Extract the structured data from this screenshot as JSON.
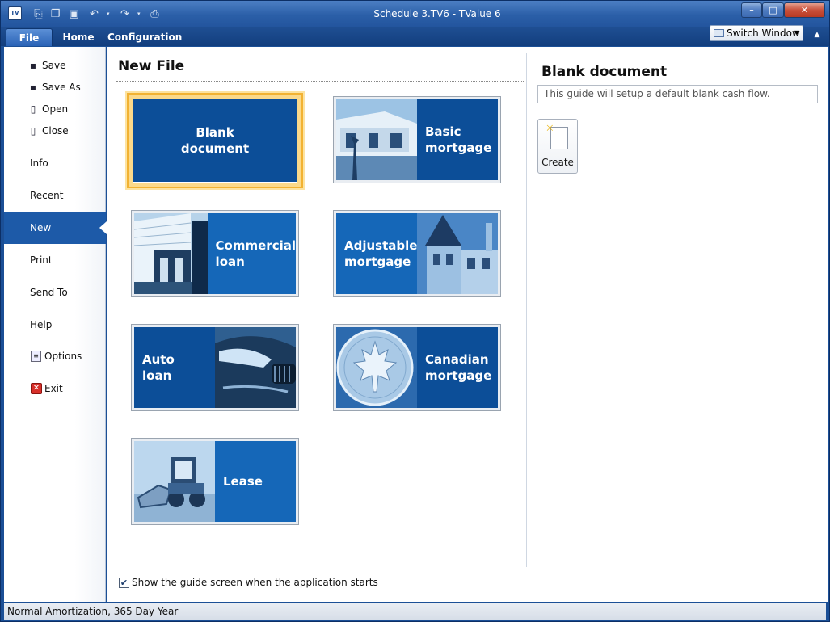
{
  "window": {
    "title": "Schedule 3.TV6 - TValue 6",
    "app_icon_text": "TV",
    "minimize_glyph": "–",
    "maximize_glyph": "□",
    "close_glyph": "✕"
  },
  "quick_access_toolbar": [
    {
      "name": "new-icon",
      "glyph": "⎘"
    },
    {
      "name": "open-icon",
      "glyph": "❐"
    },
    {
      "name": "save-icon",
      "glyph": "▣"
    },
    {
      "name": "undo-icon",
      "glyph": "↶"
    },
    {
      "name": "redo-icon",
      "glyph": "↷"
    },
    {
      "name": "print-icon",
      "glyph": "⎙"
    }
  ],
  "ribbon": {
    "tabs": [
      "File",
      "Home",
      "Configuration"
    ],
    "switch_window_label": "Switch Window"
  },
  "sidebar": {
    "save": "Save",
    "save_as": "Save As",
    "open": "Open",
    "close": "Close",
    "info": "Info",
    "recent": "Recent",
    "new": "New",
    "print": "Print",
    "send_to": "Send To",
    "help": "Help",
    "options": "Options",
    "exit": "Exit"
  },
  "main": {
    "title": "New File",
    "tiles": [
      {
        "line1": "Blank",
        "line2": "document",
        "selected": true
      },
      {
        "line1": "Basic",
        "line2": "mortgage"
      },
      {
        "line1": "Commercial",
        "line2": "loan"
      },
      {
        "line1": "Adjustable",
        "line2": "mortgage"
      },
      {
        "line1": "Auto",
        "line2": "loan"
      },
      {
        "line1": "Canadian",
        "line2": "mortgage"
      },
      {
        "line1": "Lease",
        "line2": ""
      }
    ],
    "guide_checkbox_label": "Show the guide screen when the application starts",
    "guide_checked": true
  },
  "detail": {
    "title": "Blank document",
    "description": "This guide will setup a default blank cash flow.",
    "create_label": "Create"
  },
  "statusbar": {
    "text": "Normal Amortization, 365 Day Year"
  },
  "colors": {
    "tile_blue": "#0c4e98",
    "tile_light_blue": "#1567b8",
    "selection": "#f2b232",
    "title_bar": "#2b5fa8"
  }
}
